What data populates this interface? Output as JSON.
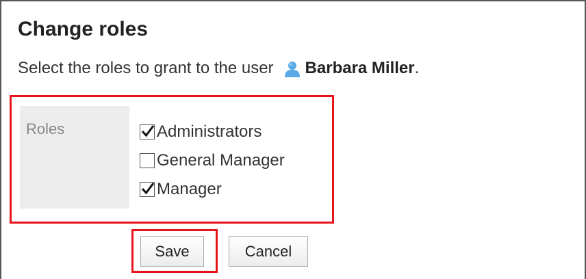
{
  "dialog": {
    "title": "Change roles",
    "description_prefix": "Select the roles to grant to the user",
    "user_name": "Barbara Miller",
    "description_suffix": "."
  },
  "roles": {
    "label": "Roles",
    "options": [
      {
        "label": "Administrators",
        "checked": true
      },
      {
        "label": "General Manager",
        "checked": false
      },
      {
        "label": "Manager",
        "checked": true
      }
    ]
  },
  "buttons": {
    "save_label": "Save",
    "cancel_label": "Cancel"
  },
  "colors": {
    "highlight": "#e8141b",
    "label_cell_bg": "#ececec",
    "user_icon": "#5aa9e6"
  },
  "icons": {
    "user": "user-icon",
    "check": "checkmark-icon"
  }
}
